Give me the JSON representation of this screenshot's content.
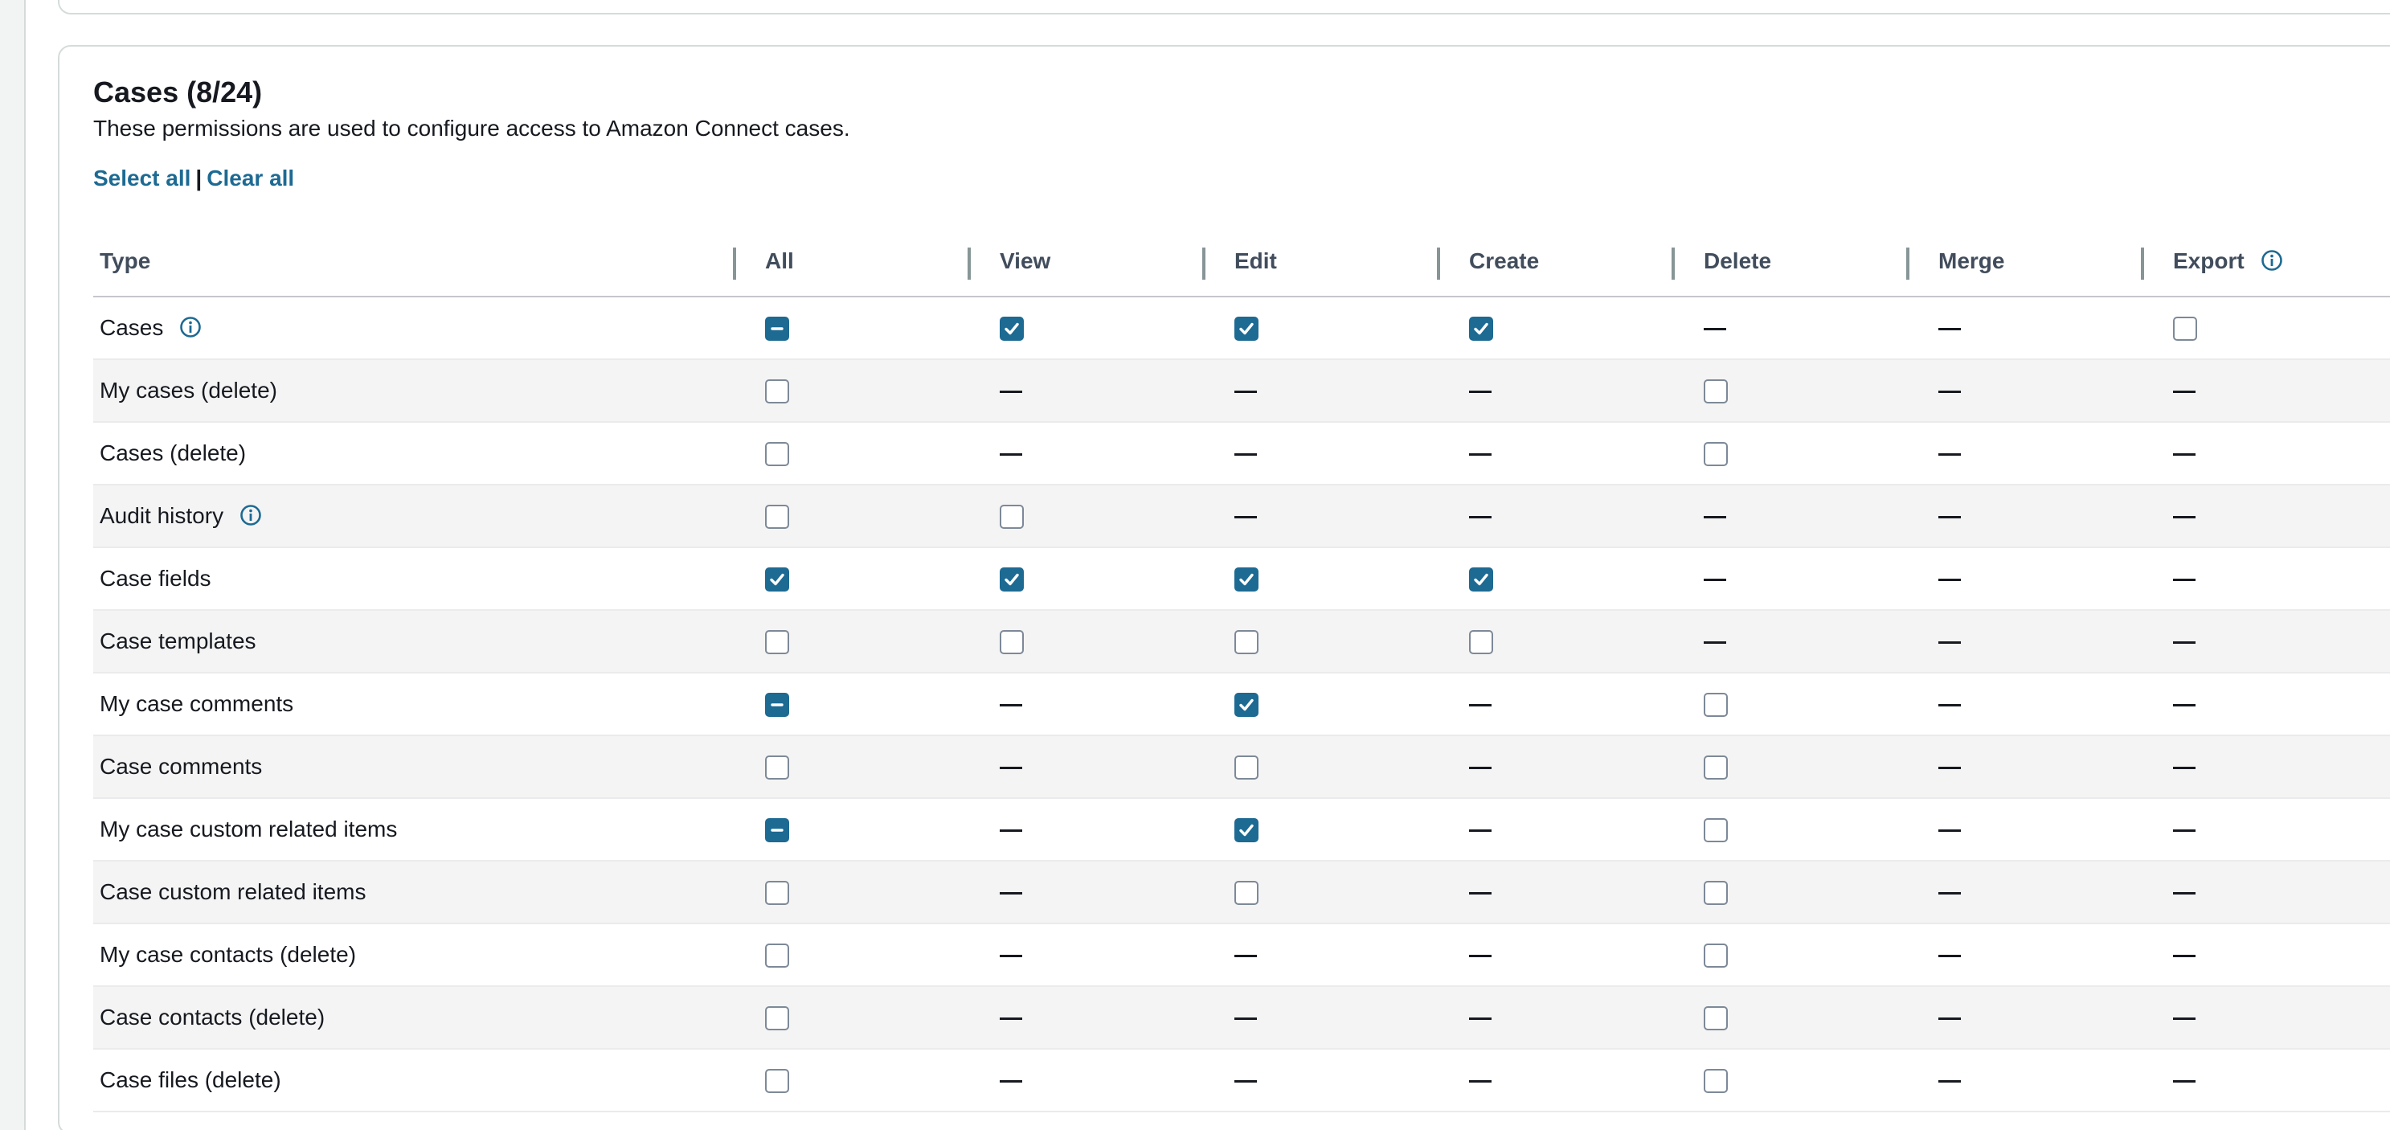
{
  "section": {
    "title": "Cases (8/24)",
    "description": "These permissions are used to configure access to Amazon Connect cases.",
    "select_all_label": "Select all",
    "separator": "|",
    "clear_all_label": "Clear all"
  },
  "table": {
    "columns": [
      {
        "key": "type",
        "label": "Type",
        "info": false
      },
      {
        "key": "all",
        "label": "All",
        "info": false
      },
      {
        "key": "view",
        "label": "View",
        "info": false
      },
      {
        "key": "edit",
        "label": "Edit",
        "info": false
      },
      {
        "key": "create",
        "label": "Create",
        "info": false
      },
      {
        "key": "delete",
        "label": "Delete",
        "info": false
      },
      {
        "key": "merge",
        "label": "Merge",
        "info": false
      },
      {
        "key": "export",
        "label": "Export",
        "info": true
      }
    ],
    "rows": [
      {
        "label": "Cases",
        "info": true,
        "cells": [
          "partial",
          "on",
          "on",
          "on",
          "na",
          "na",
          "off"
        ]
      },
      {
        "label": "My cases (delete)",
        "info": false,
        "cells": [
          "off",
          "na",
          "na",
          "na",
          "off",
          "na",
          "na"
        ]
      },
      {
        "label": "Cases (delete)",
        "info": false,
        "cells": [
          "off",
          "na",
          "na",
          "na",
          "off",
          "na",
          "na"
        ]
      },
      {
        "label": "Audit history",
        "info": true,
        "cells": [
          "off",
          "off",
          "na",
          "na",
          "na",
          "na",
          "na"
        ]
      },
      {
        "label": "Case fields",
        "info": false,
        "cells": [
          "on",
          "on",
          "on",
          "on",
          "na",
          "na",
          "na"
        ]
      },
      {
        "label": "Case templates",
        "info": false,
        "cells": [
          "off",
          "off",
          "off",
          "off",
          "na",
          "na",
          "na"
        ]
      },
      {
        "label": "My case comments",
        "info": false,
        "cells": [
          "partial",
          "na",
          "on",
          "na",
          "off",
          "na",
          "na"
        ]
      },
      {
        "label": "Case comments",
        "info": false,
        "cells": [
          "off",
          "na",
          "off",
          "na",
          "off",
          "na",
          "na"
        ]
      },
      {
        "label": "My case custom related items",
        "info": false,
        "cells": [
          "partial",
          "na",
          "on",
          "na",
          "off",
          "na",
          "na"
        ]
      },
      {
        "label": "Case custom related items",
        "info": false,
        "cells": [
          "off",
          "na",
          "off",
          "na",
          "off",
          "na",
          "na"
        ]
      },
      {
        "label": "My case contacts (delete)",
        "info": false,
        "cells": [
          "off",
          "na",
          "na",
          "na",
          "off",
          "na",
          "na"
        ]
      },
      {
        "label": "Case contacts (delete)",
        "info": false,
        "cells": [
          "off",
          "na",
          "na",
          "na",
          "off",
          "na",
          "na"
        ]
      },
      {
        "label": "Case files (delete)",
        "info": false,
        "cells": [
          "off",
          "na",
          "na",
          "na",
          "off",
          "na",
          "na"
        ]
      }
    ]
  },
  "icons": {
    "info": "info-circle-icon",
    "checked": "checkmark-icon",
    "indeterminate": "minus-icon",
    "not_applicable": "em-dash"
  },
  "colors": {
    "accent": "#1d6a93",
    "checkbox_border": "#7d8998",
    "row_alt": "#f4f4f4"
  }
}
